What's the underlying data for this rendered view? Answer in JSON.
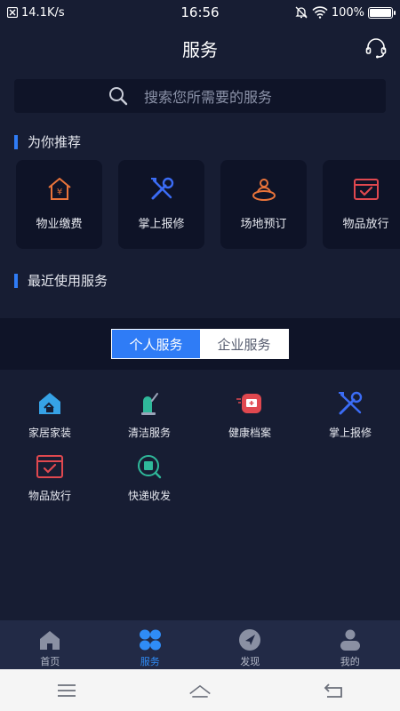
{
  "status_bar": {
    "speed": "14.1K/s",
    "time": "16:56",
    "battery": "100%"
  },
  "header": {
    "title": "服务",
    "right_icon": "headset-icon"
  },
  "search": {
    "placeholder": "搜索您所需要的服务"
  },
  "recommend": {
    "title": "为你推荐",
    "items": [
      {
        "label": "物业缴费",
        "icon": "property-fee-icon",
        "color": "#e8733a"
      },
      {
        "label": "掌上报修",
        "icon": "repair-tools-icon",
        "color": "#3b6cf5"
      },
      {
        "label": "场地预订",
        "icon": "venue-booking-icon",
        "color": "#e8733a"
      },
      {
        "label": "物品放行",
        "icon": "item-release-icon",
        "color": "#e0484f"
      }
    ]
  },
  "recent": {
    "title": "最近使用服务"
  },
  "tabs": [
    {
      "label": "个人服务",
      "active": true
    },
    {
      "label": "企业服务",
      "active": false
    }
  ],
  "services": [
    {
      "label": "家居家装",
      "icon": "home-decor-icon"
    },
    {
      "label": "清洁服务",
      "icon": "cleaning-icon"
    },
    {
      "label": "健康档案",
      "icon": "health-record-icon"
    },
    {
      "label": "掌上报修",
      "icon": "repair-tools-icon"
    },
    {
      "label": "物品放行",
      "icon": "item-release-icon"
    },
    {
      "label": "快递收发",
      "icon": "express-delivery-icon"
    }
  ],
  "bottom_nav": [
    {
      "label": "首页",
      "icon": "home-icon",
      "active": false
    },
    {
      "label": "服务",
      "icon": "services-grid-icon",
      "active": true
    },
    {
      "label": "发现",
      "icon": "discover-icon",
      "active": false
    },
    {
      "label": "我的",
      "icon": "profile-icon",
      "active": false
    }
  ],
  "colors": {
    "background": "#171d33",
    "accent": "#2f7cf6",
    "card": "#0e1327",
    "nav_bar": "#222a46"
  }
}
